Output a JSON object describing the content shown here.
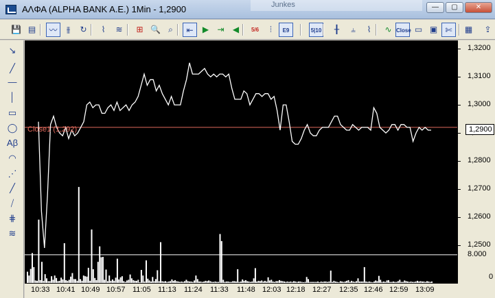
{
  "window": {
    "title": "ΑΛΦΑ (ALPHA BANK A.E.) 1Min - 1,2900",
    "background_tab": "Junkes",
    "controls": {
      "minimize": "—",
      "maximize": "▢",
      "close": "✕"
    }
  },
  "chart": {
    "close_line_label": "Close1 (1,292)",
    "close_line_value": 1.292,
    "current_price_label": "1,2900",
    "price_axis": {
      "ticks": [
        "1,3200",
        "1,3100",
        "1,3000",
        "1,2900",
        "1,2800",
        "1,2700",
        "1,2600",
        "1,2500"
      ],
      "range": [
        1.2485,
        1.3225
      ]
    },
    "volume_axis": {
      "ticks": [
        "8.000",
        "0"
      ],
      "max": 30000
    },
    "time_ticks": [
      "10:33",
      "10:41",
      "10:49",
      "10:57",
      "11:05",
      "11:13",
      "11:24",
      "11:33",
      "11:48",
      "12:03",
      "12:18",
      "12:27",
      "12:35",
      "12:46",
      "12:59",
      "13:09"
    ],
    "price_series": [
      1.294,
      1.262,
      1.249,
      1.268,
      1.293,
      1.296,
      1.292,
      1.29,
      1.289,
      1.292,
      1.288,
      1.291,
      1.289,
      1.29,
      1.292,
      1.294,
      1.3,
      1.301,
      1.299,
      1.3,
      1.3,
      1.297,
      1.297,
      1.299,
      1.3,
      1.298,
      1.301,
      1.298,
      1.299,
      1.3,
      1.298,
      1.3,
      1.301,
      1.303,
      1.307,
      1.311,
      1.307,
      1.309,
      1.309,
      1.305,
      1.307,
      1.304,
      1.302,
      1.3,
      1.303,
      1.3,
      1.3,
      1.3,
      1.305,
      1.309,
      1.315,
      1.311,
      1.311,
      1.311,
      1.312,
      1.313,
      1.311,
      1.31,
      1.311,
      1.31,
      1.311,
      1.311,
      1.31,
      1.311,
      1.306,
      1.302,
      1.302,
      1.302,
      1.305,
      1.304,
      1.3,
      1.302,
      1.304,
      1.304,
      1.303,
      1.304,
      1.304,
      1.302,
      1.303,
      1.298,
      1.291,
      1.3,
      1.3,
      1.294,
      1.287,
      1.286,
      1.286,
      1.288,
      1.291,
      1.293,
      1.29,
      1.289,
      1.289,
      1.291,
      1.292,
      1.292,
      1.292,
      1.294,
      1.296,
      1.296,
      1.293,
      1.292,
      1.291,
      1.291,
      1.293,
      1.292,
      1.291,
      1.292,
      1.292,
      1.292,
      1.291,
      1.299,
      1.297,
      1.292,
      1.291,
      1.29,
      1.291,
      1.293,
      1.293,
      1.291,
      1.293,
      1.293,
      1.292,
      1.292,
      1.287,
      1.29,
      1.292,
      1.291,
      1.292,
      1.291,
      1.291
    ],
    "volume_series": [
      3200,
      2100,
      4000,
      8500,
      4500,
      700,
      600,
      18000,
      800,
      6000,
      600,
      2500,
      1300,
      500,
      500,
      1900,
      900,
      2100,
      1400,
      500,
      600,
      1500,
      1000,
      11300,
      800,
      600,
      900,
      1800,
      2800,
      1100,
      1100,
      600,
      27300,
      1100,
      600,
      2100,
      1900,
      1800,
      4300,
      600,
      15200,
      3900,
      1400,
      800,
      6000,
      10400,
      7300,
      7400,
      900,
      3800,
      500,
      2100,
      600,
      1000,
      600,
      1500,
      6900,
      1000,
      1600,
      1900,
      500,
      300,
      700,
      900,
      2400,
      1300,
      800,
      600,
      600,
      900,
      200,
      3700,
      2100,
      400,
      6400,
      1200,
      700,
      400,
      1700,
      500,
      1100,
      3600,
      500,
      11600,
      500,
      400,
      500,
      300,
      400,
      500,
      1000,
      600,
      800,
      500,
      400,
      300,
      400,
      300,
      500,
      900,
      500,
      400,
      400,
      300,
      700,
      2100,
      1100,
      400,
      400,
      300,
      400,
      600,
      500,
      700,
      500,
      300,
      300,
      400,
      300,
      300,
      13900,
      11900,
      900,
      300,
      400,
      400,
      300,
      300,
      500,
      500,
      400,
      3900,
      300,
      400,
      1000,
      600,
      800,
      500,
      400,
      300,
      400,
      1300,
      4200,
      400,
      600,
      500,
      700,
      400,
      600,
      400,
      1600,
      700,
      900,
      400,
      300,
      500,
      500,
      800,
      600,
      500,
      400,
      300,
      400,
      300,
      400,
      300,
      500,
      400,
      300,
      400,
      400,
      300,
      200,
      300,
      1700,
      1100,
      300,
      300,
      300,
      300,
      300,
      400,
      200,
      400,
      300,
      400,
      400,
      300,
      400,
      3500,
      300,
      600,
      400,
      300,
      200,
      500,
      400,
      300,
      400,
      600,
      800,
      300,
      600,
      400,
      300,
      500,
      1300,
      400,
      400,
      400,
      4500,
      400,
      300,
      400,
      300,
      200,
      400,
      700,
      500,
      2000,
      900,
      300,
      400,
      300,
      700,
      800,
      300,
      300,
      400,
      300,
      300,
      500,
      900,
      300,
      300,
      700,
      500,
      400,
      300,
      400,
      300,
      300,
      400,
      600,
      400,
      500,
      400,
      400,
      300,
      500,
      400,
      300,
      400
    ],
    "colors": {
      "background": "#000000",
      "line": "#ffffff",
      "close_line": "#e06a5c",
      "volume_ref": "#ffffff"
    }
  },
  "toolbar": [
    {
      "name": "save-icon",
      "glyph": "💾"
    },
    {
      "name": "properties-icon",
      "glyph": "▤"
    },
    {
      "name": "line-chart-icon",
      "glyph": "〰"
    },
    {
      "name": "bar-chart-icon",
      "glyph": "⫵"
    },
    {
      "name": "refresh-icon",
      "glyph": "↻"
    },
    {
      "name": "indicator-icon",
      "glyph": "⌇"
    },
    {
      "name": "chart-style-icon",
      "glyph": "≋"
    },
    {
      "name": "hierarchy-icon",
      "glyph": "⊞"
    },
    {
      "name": "zoom-in-icon",
      "glyph": "🔍"
    },
    {
      "name": "zoom-out-icon",
      "glyph": "⌕"
    },
    {
      "name": "scroll-start-icon",
      "glyph": "⇤"
    },
    {
      "name": "play-icon",
      "glyph": "▶"
    },
    {
      "name": "scroll-end-icon",
      "glyph": "⇥"
    },
    {
      "name": "step-back-icon",
      "glyph": "◀"
    },
    {
      "name": "fraction-icon",
      "glyph": "5/6"
    },
    {
      "name": "grid-icon",
      "glyph": "⦙"
    },
    {
      "name": "text-icon",
      "glyph": "E9"
    },
    {
      "name": "ratio-icon",
      "glyph": "5|10"
    },
    {
      "name": "candlestick-icon",
      "glyph": "╂"
    },
    {
      "name": "ohlc-icon",
      "glyph": "⫨"
    },
    {
      "name": "line-icon",
      "glyph": "⌇"
    },
    {
      "name": "dot-line-icon",
      "glyph": "∿"
    },
    {
      "name": "close-icon",
      "glyph": "Close"
    },
    {
      "name": "layout-icon",
      "glyph": "▭"
    },
    {
      "name": "window-icon",
      "glyph": "▣"
    },
    {
      "name": "tools-icon",
      "glyph": "✄"
    },
    {
      "name": "report-icon",
      "glyph": "▦"
    },
    {
      "name": "export-icon",
      "glyph": "⇪"
    }
  ],
  "left_tools": [
    {
      "name": "cursor-tool-icon",
      "glyph": "↘"
    },
    {
      "name": "trendline-tool-icon",
      "glyph": "╱"
    },
    {
      "name": "horizontal-line-tool-icon",
      "glyph": "—"
    },
    {
      "name": "vertical-line-tool-icon",
      "glyph": "│"
    },
    {
      "name": "rectangle-tool-icon",
      "glyph": "▭"
    },
    {
      "name": "ellipse-tool-icon",
      "glyph": "◯"
    },
    {
      "name": "text-tool-icon",
      "glyph": "Aβ"
    },
    {
      "name": "arc-tool-icon",
      "glyph": "◠"
    },
    {
      "name": "fan-tool-icon",
      "glyph": "⋰"
    },
    {
      "name": "ray-tool-icon",
      "glyph": "╱"
    },
    {
      "name": "channel-tool-icon",
      "glyph": "⧸"
    },
    {
      "name": "fibonacci-tool-icon",
      "glyph": "⋕"
    },
    {
      "name": "gann-tool-icon",
      "glyph": "≋"
    }
  ]
}
